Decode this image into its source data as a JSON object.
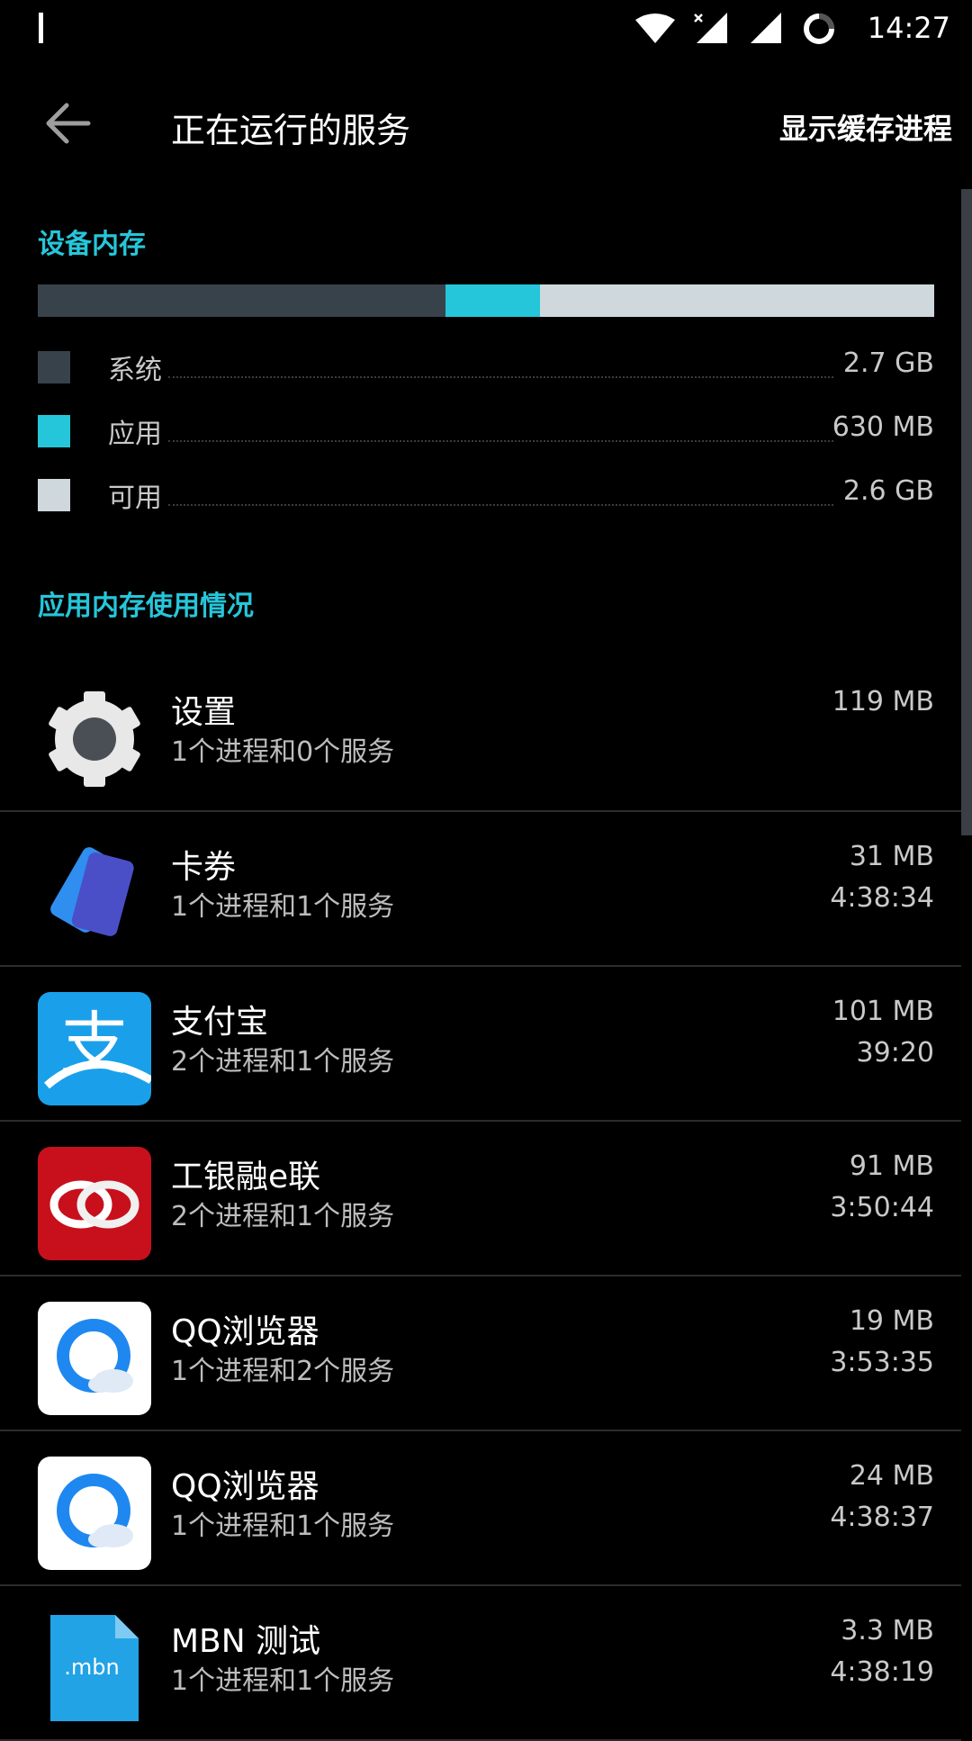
{
  "status_bar": {
    "time": "14:27",
    "icons": [
      "wifi-icon",
      "signal-x-icon",
      "signal-icon",
      "sync-icon"
    ]
  },
  "header": {
    "title": "正在运行的服务",
    "action": "显示缓存进程",
    "back_icon": "arrow-back-icon"
  },
  "device_memory": {
    "section_title": "设备内存",
    "bar": [
      {
        "name": "系统",
        "fraction": 0.455,
        "color": "#37424a"
      },
      {
        "name": "应用",
        "fraction": 0.105,
        "color": "#26c6da"
      },
      {
        "name": "可用",
        "fraction": 0.44,
        "color": "#cfd8dc"
      }
    ],
    "legend": [
      {
        "label": "系统",
        "value": "2.7 GB",
        "color": "#37424a"
      },
      {
        "label": "应用",
        "value": "630 MB",
        "color": "#26c6da"
      },
      {
        "label": "可用",
        "value": "2.6 GB",
        "color": "#cfd8dc"
      }
    ]
  },
  "app_memory": {
    "section_title": "应用内存使用情况",
    "apps": [
      {
        "name": "设置",
        "subtitle": "1个进程和0个服务",
        "size": "119 MB",
        "time": "",
        "icon": "settings-gear-icon"
      },
      {
        "name": "卡券",
        "subtitle": "1个进程和1个服务",
        "size": "31 MB",
        "time": "4:38:34",
        "icon": "cards-icon"
      },
      {
        "name": "支付宝",
        "subtitle": "2个进程和1个服务",
        "size": "101 MB",
        "time": "39:20",
        "icon": "alipay-icon",
        "icon_glyph": "支"
      },
      {
        "name": "工银融e联",
        "subtitle": "2个进程和1个服务",
        "size": "91 MB",
        "time": "3:50:44",
        "icon": "icbc-rings-icon"
      },
      {
        "name": "QQ浏览器",
        "subtitle": "1个进程和2个服务",
        "size": "19 MB",
        "time": "3:53:35",
        "icon": "qq-browser-icon"
      },
      {
        "name": "QQ浏览器",
        "subtitle": "1个进程和1个服务",
        "size": "24 MB",
        "time": "4:38:37",
        "icon": "qq-browser-icon"
      },
      {
        "name": "MBN 测试",
        "subtitle": "1个进程和1个服务",
        "size": "3.3 MB",
        "time": "4:38:19",
        "icon": "mbn-file-icon",
        "icon_glyph": ".mbn"
      }
    ]
  }
}
